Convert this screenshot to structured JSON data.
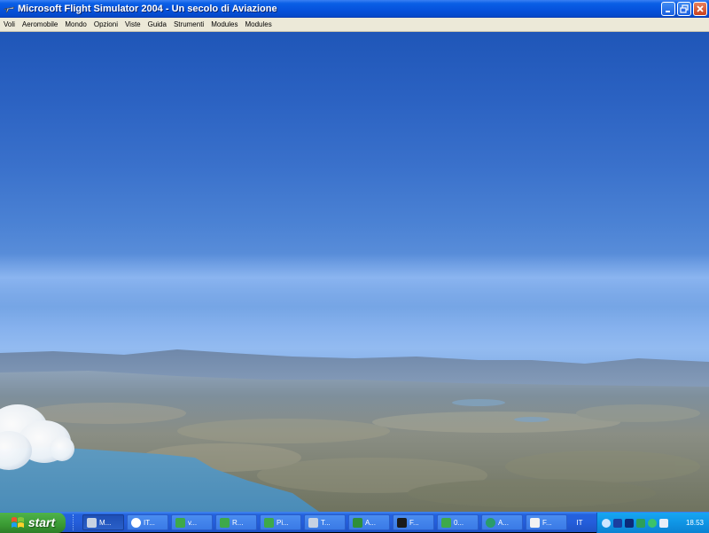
{
  "window": {
    "title": "Microsoft Flight Simulator 2004 - Un secolo di Aviazione",
    "icon": "plane-icon",
    "controls": [
      "minimize-icon",
      "restore-icon",
      "close-icon"
    ]
  },
  "menu": {
    "items": [
      "Voli",
      "Aeromobile",
      "Mondo",
      "Opzioni",
      "Viste",
      "Guida",
      "Strumenti",
      "Modules",
      "Modules"
    ]
  },
  "viewport": {
    "scene": "aerial-sky-and-terrain"
  },
  "taskbar": {
    "start_label": "start",
    "tasks": [
      {
        "label": "M...",
        "icon": "plane-icon",
        "active": true
      },
      {
        "label": "IT...",
        "icon": "browser-icon",
        "active": false
      },
      {
        "label": "v...",
        "icon": "spreadsheet-icon",
        "active": false
      },
      {
        "label": "R...",
        "icon": "spreadsheet-icon",
        "active": false
      },
      {
        "label": "Pi...",
        "icon": "spreadsheet-icon",
        "active": false
      },
      {
        "label": "T...",
        "icon": "plane-icon",
        "active": false
      },
      {
        "label": "A...",
        "icon": "utility-icon",
        "active": false
      },
      {
        "label": "F...",
        "icon": "monitor-icon",
        "active": false
      },
      {
        "label": "0...",
        "icon": "spreadsheet-icon",
        "active": false
      },
      {
        "label": "A...",
        "icon": "globe-icon",
        "active": false
      },
      {
        "label": "F...",
        "icon": "document-icon",
        "active": false
      }
    ],
    "language": "IT",
    "tray_icons": [
      "network-icon",
      "antivirus-icon",
      "media-icon",
      "update-icon",
      "user-icon",
      "volume-icon"
    ],
    "clock": "18.53"
  },
  "colors": {
    "titlebar": "#0652dc",
    "menubar": "#ece9d8",
    "taskbar": "#245edb",
    "start": "#3a9a33",
    "tray": "#0f95e5"
  }
}
